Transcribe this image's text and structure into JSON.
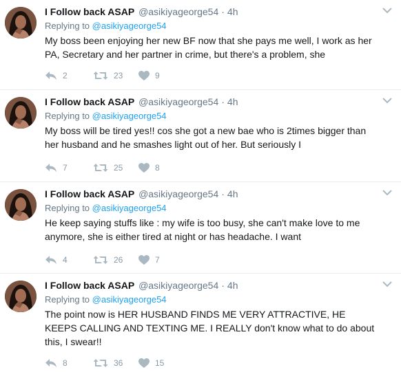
{
  "colors": {
    "text": "#14171a",
    "secondary": "#657786",
    "mention": "#1da1f2",
    "action": "#8899a6",
    "divider": "#e6ecf0"
  },
  "icons": {
    "reply": "reply-icon",
    "retweet": "retweet-icon",
    "like": "heart-icon",
    "menu": "chevron-down-icon"
  },
  "tweets": [
    {
      "name": "I Follow back ASAP",
      "handle": "@asikiyageorge54",
      "dot": "·",
      "time": "4h",
      "replying_prefix": "Replying to ",
      "replying_to": "@asikiyageorge54",
      "text": "My boss been enjoying her new BF now that she pays me well, I work as her PA, Secretary and her partner in crime, but there's a problem, she",
      "replies": "2",
      "retweets": "23",
      "likes": "9"
    },
    {
      "name": "I Follow back ASAP",
      "handle": "@asikiyageorge54",
      "dot": "·",
      "time": "4h",
      "replying_prefix": "Replying to ",
      "replying_to": "@asikiyageorge54",
      "text": "My boss will be tired yes!! cos she got a new bae who is 2times bigger than her husband and he smashes light out of her. But seriously I",
      "replies": "7",
      "retweets": "25",
      "likes": "8"
    },
    {
      "name": "I Follow back ASAP",
      "handle": "@asikiyageorge54",
      "dot": "·",
      "time": "4h",
      "replying_prefix": "Replying to ",
      "replying_to": "@asikiyageorge54",
      "text": "He keep saying stuffs like : my wife is too busy, she can't make love to me anymore, she is either tired at night or has headache. I want",
      "replies": "4",
      "retweets": "26",
      "likes": "7"
    },
    {
      "name": "I Follow back ASAP",
      "handle": "@asikiyageorge54",
      "dot": "·",
      "time": "4h",
      "replying_prefix": "Replying to ",
      "replying_to": "@asikiyageorge54",
      "text": "The point now is HER HUSBAND FINDS ME VERY ATTRACTIVE, HE KEEPS CALLING AND TEXTING ME. I REALLY don't know what to do about this, I swear!!",
      "replies": "8",
      "retweets": "36",
      "likes": "15"
    }
  ]
}
